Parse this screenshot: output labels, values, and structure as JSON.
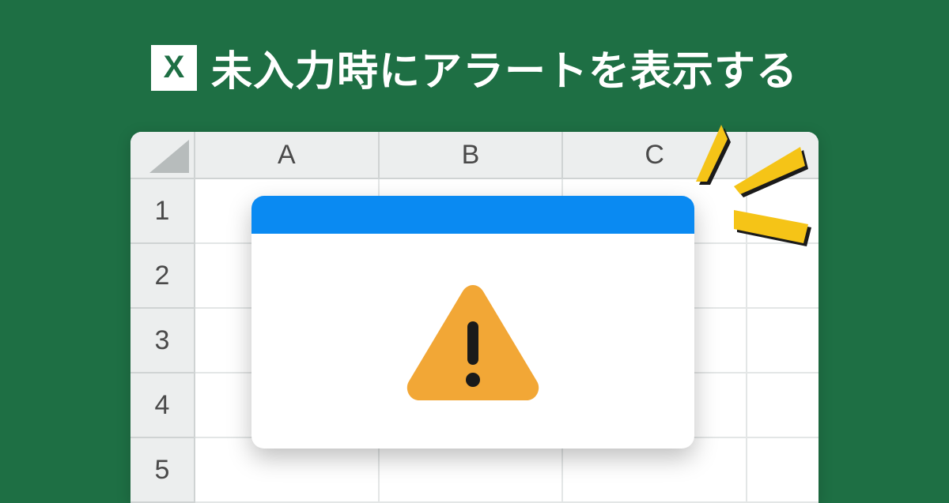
{
  "header": {
    "logo_text": "X",
    "title": "未入力時にアラートを表示する"
  },
  "spreadsheet": {
    "columns": [
      "A",
      "B",
      "C",
      ""
    ],
    "rows": [
      "1",
      "2",
      "3",
      "4",
      "5"
    ]
  },
  "dialog": {
    "icon": "warning-triangle"
  }
}
